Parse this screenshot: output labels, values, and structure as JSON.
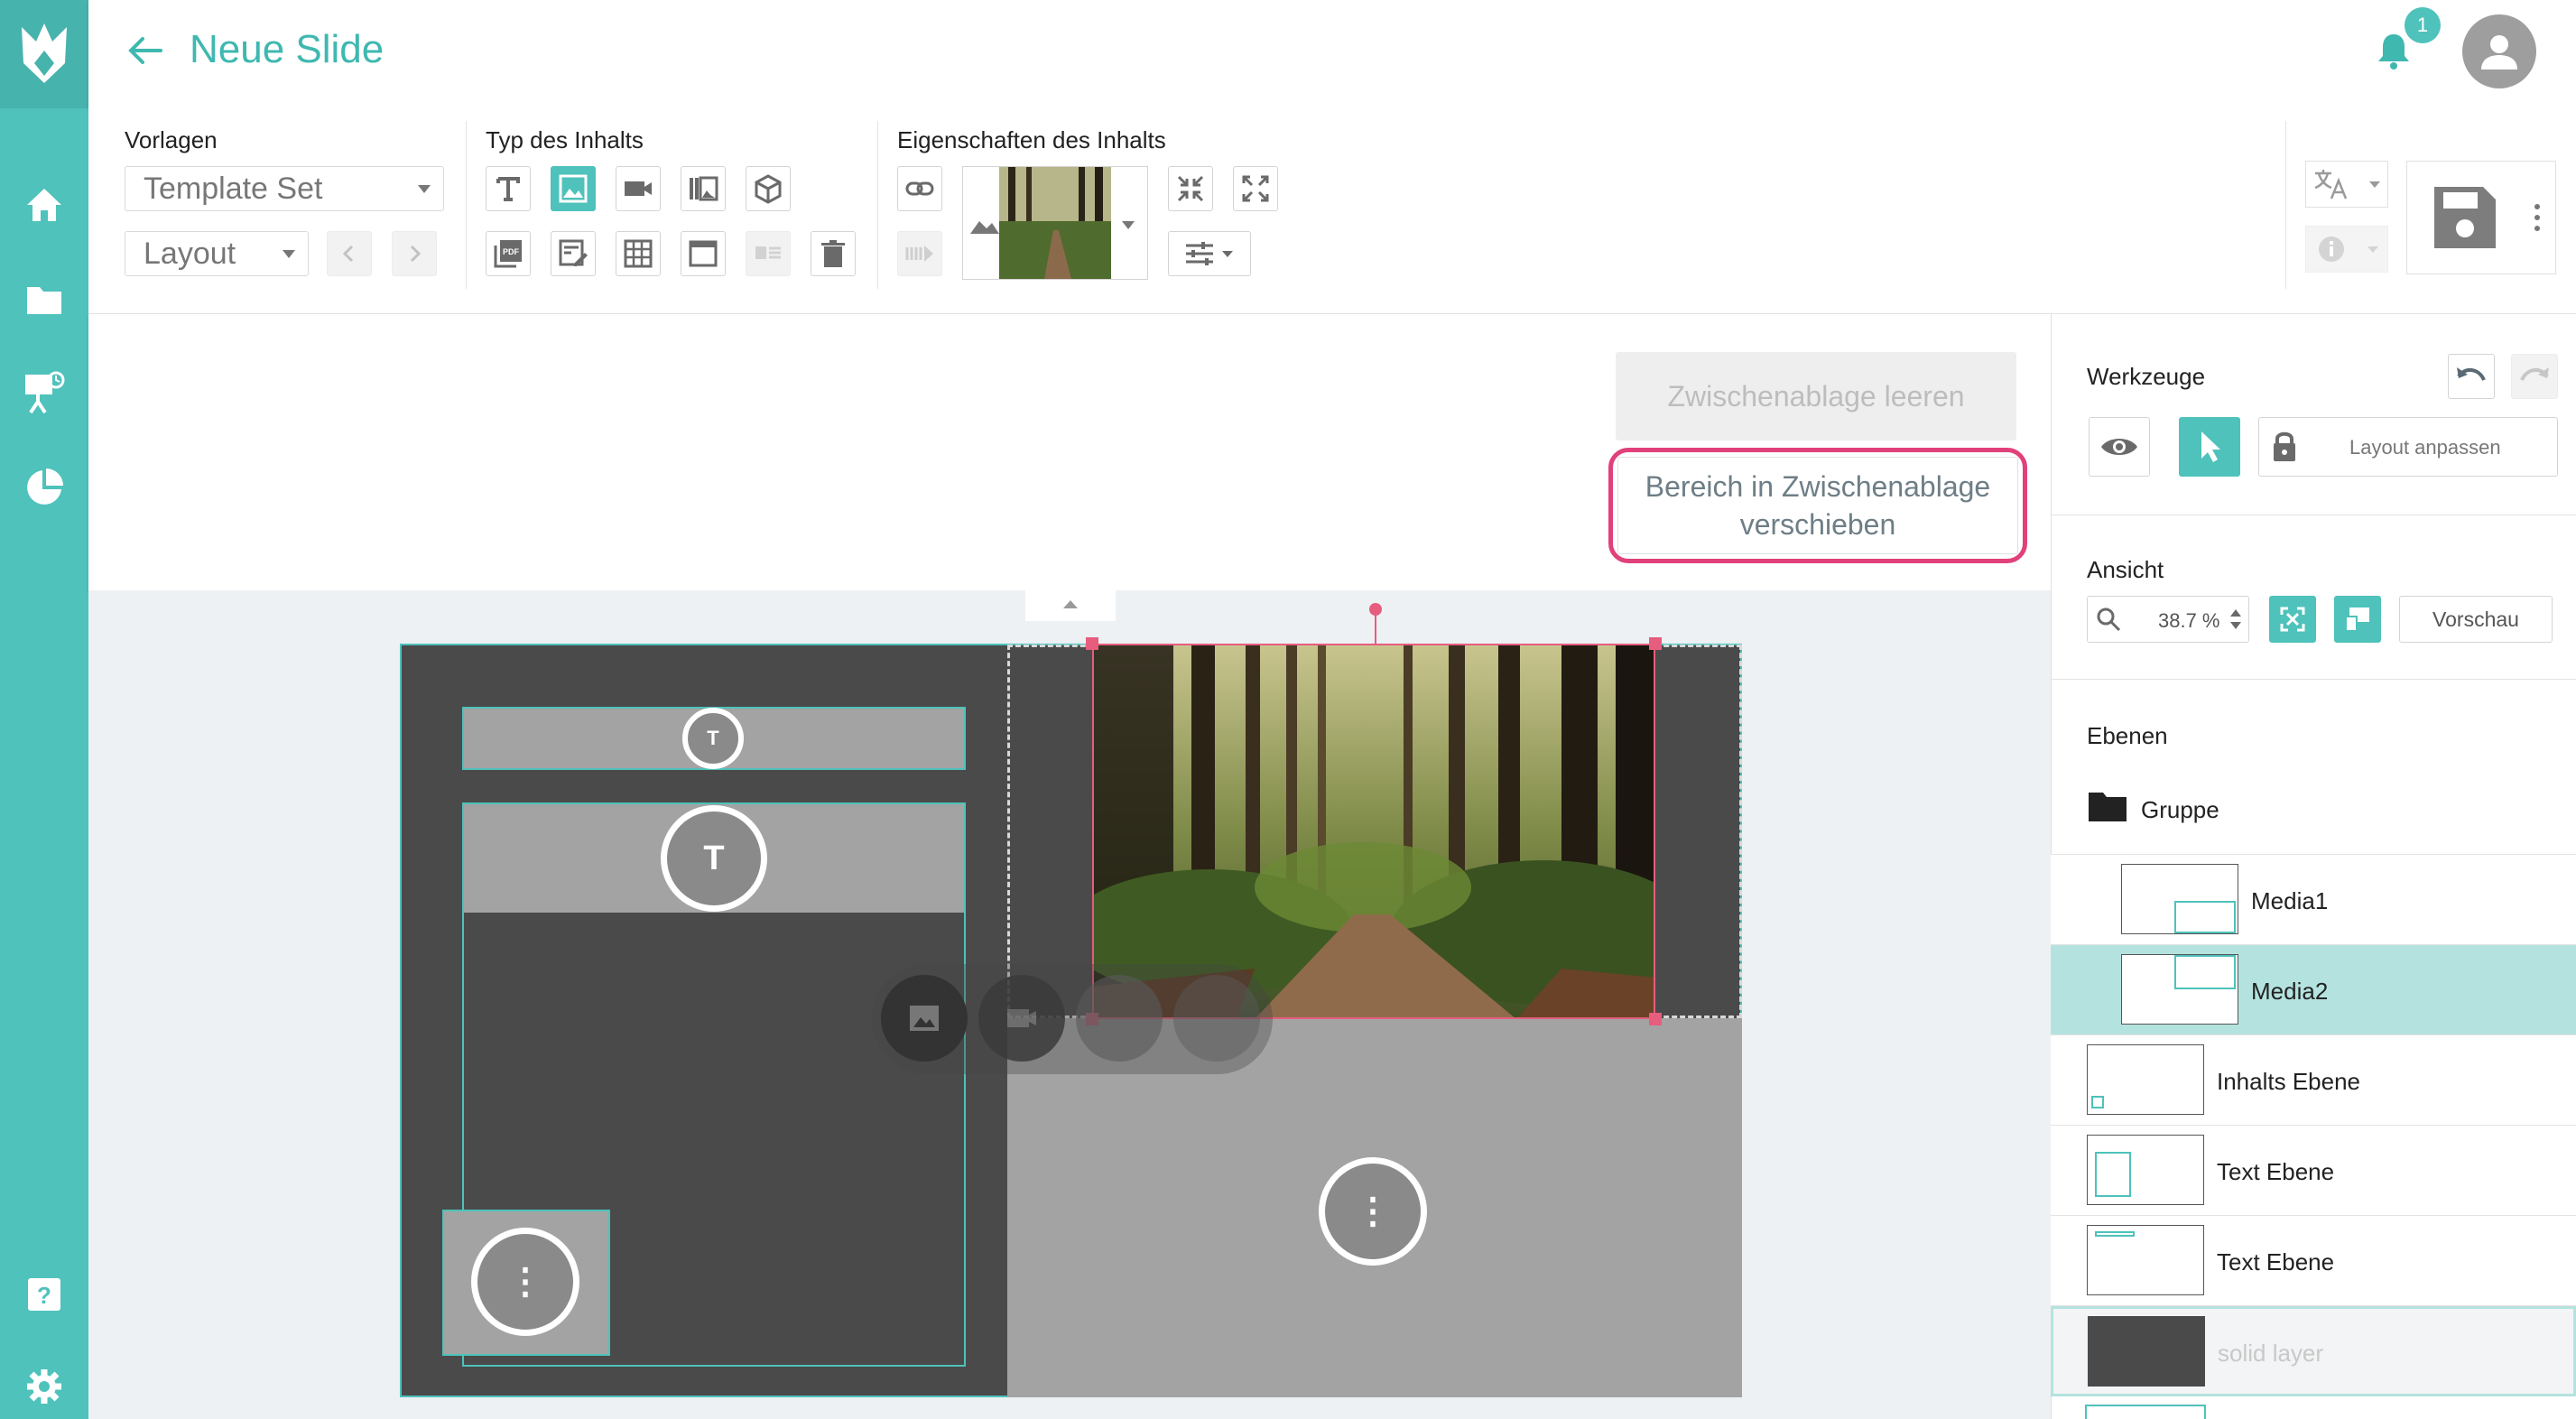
{
  "header": {
    "title": "Neue Slide",
    "notification_count": "1"
  },
  "toolbar": {
    "vorlagen_label": "Vorlagen",
    "template_set_value": "Template Set",
    "layout_value": "Layout",
    "typ_label": "Typ des Inhalts",
    "eigenschaften_label": "Eigenschaften des Inhalts"
  },
  "clipboard": {
    "clear_label": "Zwischenablage leeren",
    "move_label_line1": "Bereich in Zwischenablage",
    "move_label_line2": "verschieben"
  },
  "tools": {
    "title": "Werkzeuge",
    "layout_adjust_label": "Layout anpassen"
  },
  "view": {
    "title": "Ansicht",
    "zoom_value": "38.7 %",
    "preview_label": "Vorschau"
  },
  "layers": {
    "title": "Ebenen",
    "group_label": "Gruppe",
    "items": [
      {
        "name": "Media1"
      },
      {
        "name": "Media2"
      },
      {
        "name": "Inhalts Ebene"
      },
      {
        "name": "Text Ebene"
      },
      {
        "name": "Text Ebene"
      },
      {
        "name": "solid layer"
      }
    ]
  },
  "canvas": {
    "text_marker": "T",
    "more_marker": "⋮"
  },
  "colors": {
    "brand_teal": "#4ec2bb",
    "highlight_pink": "#e0417a",
    "selected_layer_bg": "#b4e3df"
  }
}
